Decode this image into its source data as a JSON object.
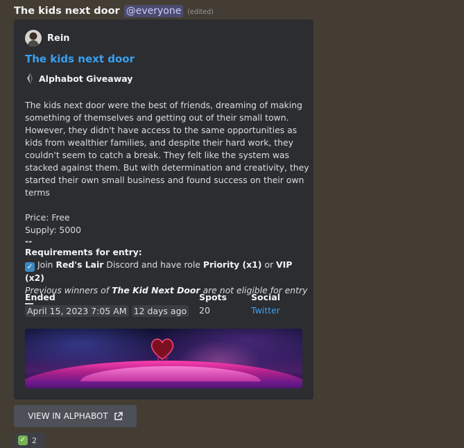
{
  "message": {
    "title": "The kids next door",
    "mention": "@everyone",
    "edited": "(edited)"
  },
  "embed": {
    "author": "Rein",
    "title": "The kids next door",
    "provider": "Alphabot Giveaway",
    "description": "The kids next door were the best of friends, dreaming of making something of themselves and getting out of their small town. However, they didn't have access to the same opportunities as kids from wealthier families, and despite their hard work, they couldn't seem to catch a break. They felt like the system was stacked against them. But with determination and creativity, they started their own small business and found success on their own terms",
    "price": "Price: Free",
    "supply": "Supply: 5000",
    "separator": "--",
    "requirements_title": "Requirements for entry:",
    "req_join": "Join",
    "req_server": "Red's Lair",
    "req_mid": "Discord and have role",
    "req_role1": "Priority (x1)",
    "req_or": "or",
    "req_role2": "VIP (x2)",
    "prev_prefix": "Previous winners of",
    "prev_project": "The Kid Next Door",
    "prev_suffix": "are not eligible for entry",
    "fields": {
      "ended": {
        "name": "Ended",
        "date": "April 15, 2023 7:05 AM",
        "relative": "12 days ago"
      },
      "spots": {
        "name": "Spots",
        "value": "20"
      },
      "social": {
        "name": "Social",
        "value": "Twitter"
      }
    }
  },
  "button": {
    "label": "VIEW IN ALPHABOT"
  },
  "reaction": {
    "count": "2"
  },
  "colors": {
    "link": "#3aa0f0",
    "embed_bg": "#2b2d31",
    "page_bg": "#433d33"
  },
  "icons": {
    "provider": "alphabot-logo-icon",
    "external": "external-link-icon",
    "check": "check-mark-icon"
  }
}
